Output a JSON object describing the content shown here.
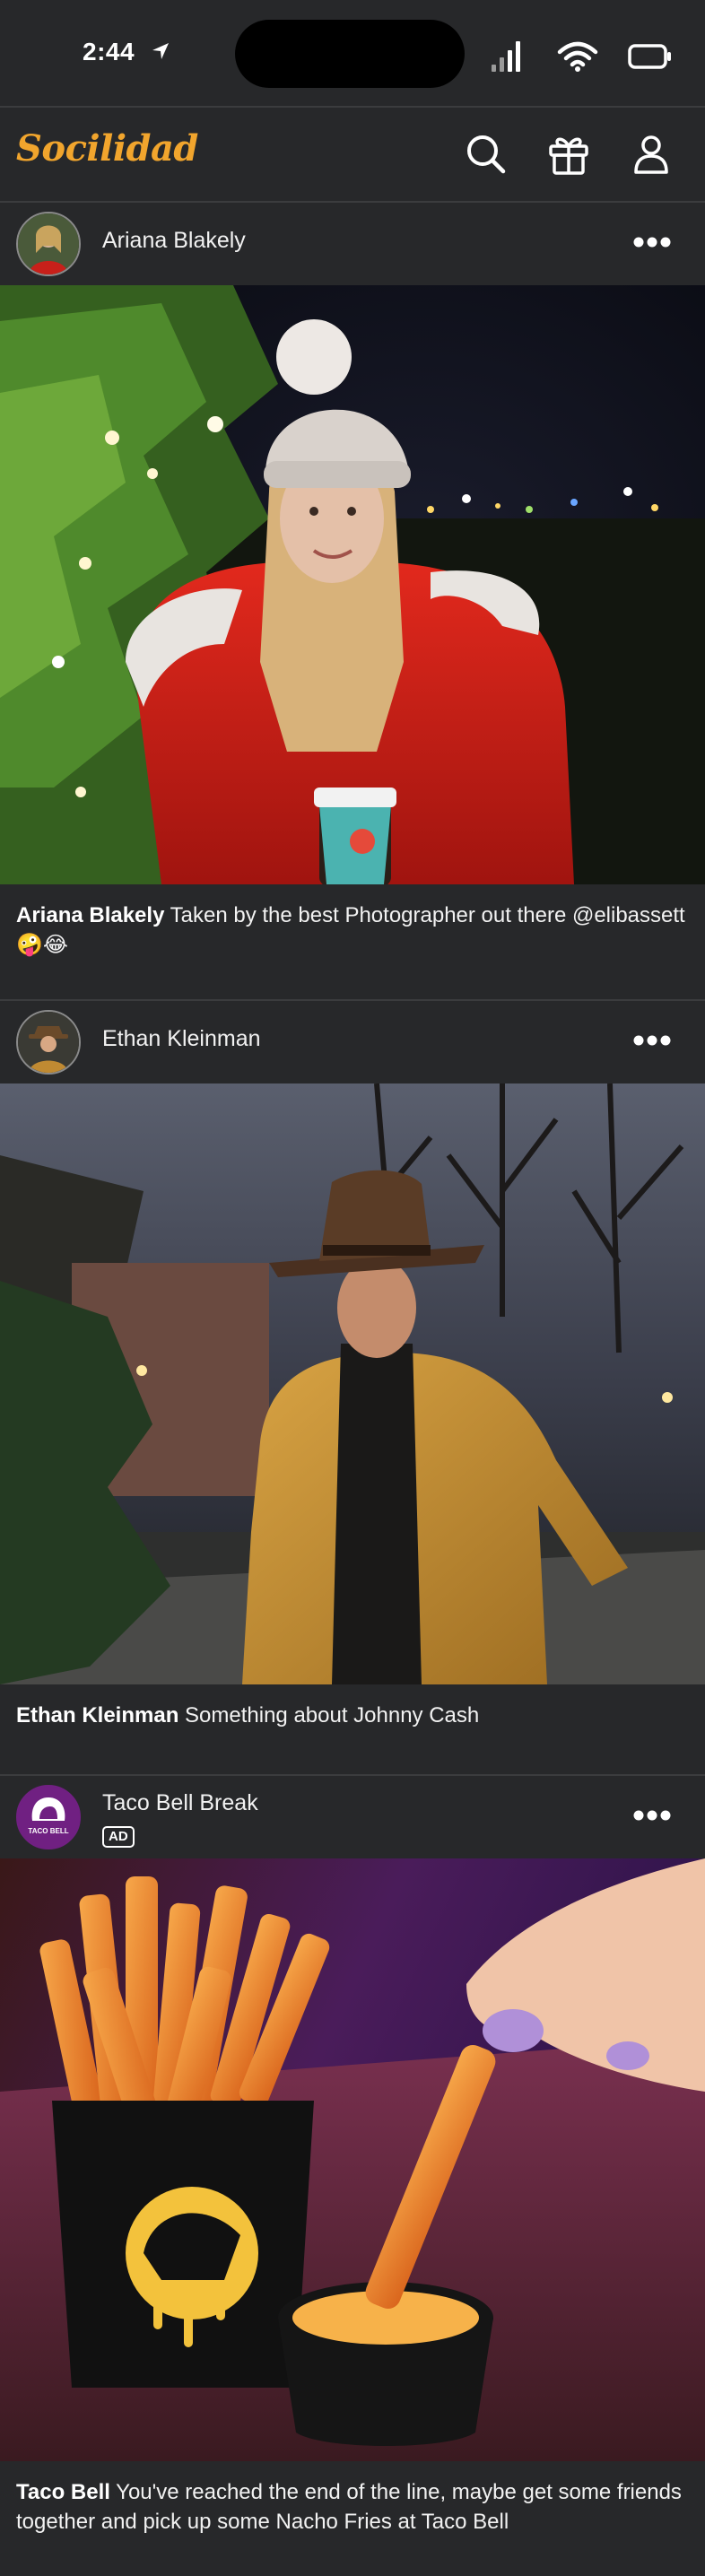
{
  "status_bar": {
    "time": "2:44"
  },
  "app": {
    "name": "Socilidad"
  },
  "posts": [
    {
      "author": "Ariana Blakely",
      "caption_author": "Ariana Blakely",
      "caption_text": "Taken by the best Photographer out there @elibassett 🤪😂"
    },
    {
      "author": "Ethan Kleinman",
      "caption_author": "Ethan Kleinman",
      "caption_text": "Something about Johnny Cash"
    },
    {
      "author": "Taco Bell Break",
      "badge": "AD",
      "avatar_text": "TACO BELL",
      "caption_author": "Taco Bell",
      "caption_text": "You've reached the end of the line, maybe get some friends together and pick up some Nacho Fries at Taco Bell"
    }
  ],
  "colors": {
    "background": "#27282a",
    "brand": "#f1a52d",
    "divider": "#3b3c3e",
    "taco_bell_purple": "#702082"
  }
}
